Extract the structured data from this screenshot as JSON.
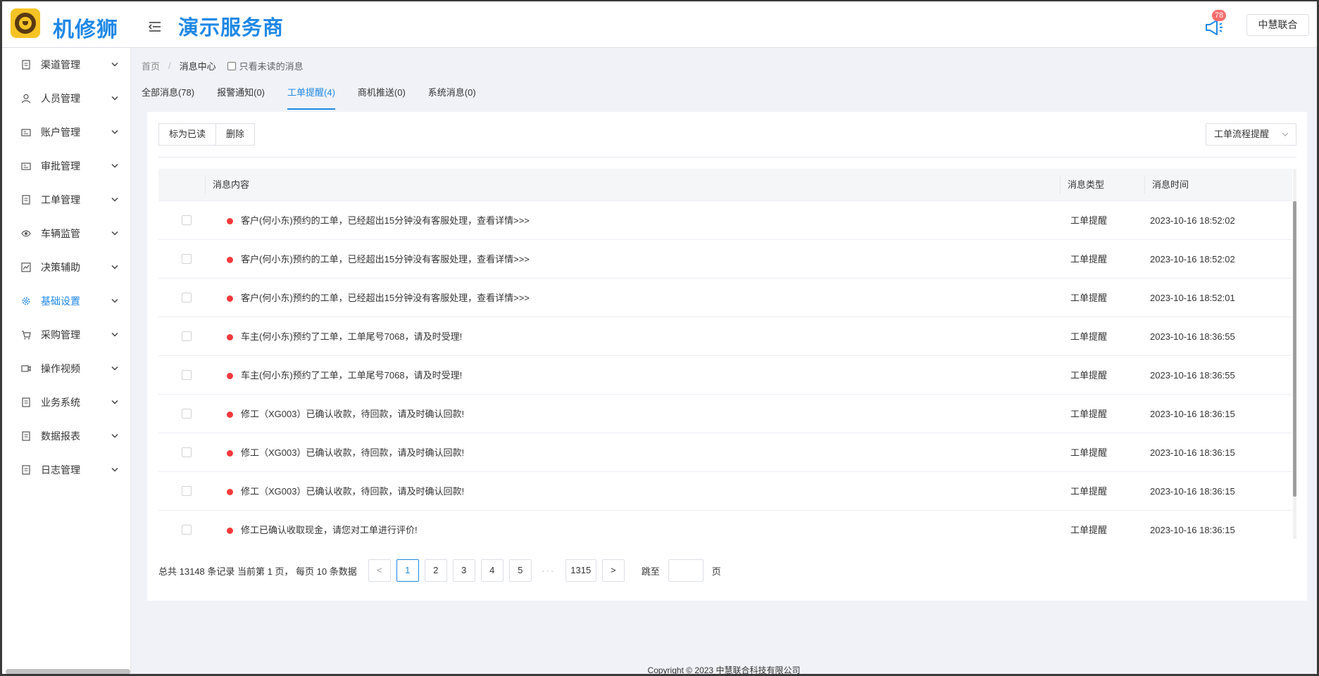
{
  "header": {
    "app_name": "机修狮",
    "provider": "演示服务商",
    "notification_count": "78",
    "org_button": "中慧联合"
  },
  "sidebar": {
    "items": [
      {
        "label": "渠道管理",
        "icon": "document-icon"
      },
      {
        "label": "人员管理",
        "icon": "user-icon"
      },
      {
        "label": "账户管理",
        "icon": "id-card-icon"
      },
      {
        "label": "审批管理",
        "icon": "id-card-icon"
      },
      {
        "label": "工单管理",
        "icon": "document-icon"
      },
      {
        "label": "车辆监管",
        "icon": "eye-icon"
      },
      {
        "label": "决策辅助",
        "icon": "chart-icon"
      },
      {
        "label": "基础设置",
        "icon": "gear-icon",
        "active": true
      },
      {
        "label": "采购管理",
        "icon": "cart-icon"
      },
      {
        "label": "操作视频",
        "icon": "video-icon"
      },
      {
        "label": "业务系统",
        "icon": "document-icon"
      },
      {
        "label": "数据报表",
        "icon": "document-icon"
      },
      {
        "label": "日志管理",
        "icon": "document-icon"
      }
    ]
  },
  "breadcrumb": {
    "home": "首页",
    "separator": "/",
    "current": "消息中心",
    "unread_only_label": "只看未读的消息"
  },
  "tabs": [
    {
      "label": "全部消息(78)"
    },
    {
      "label": "报警通知(0)"
    },
    {
      "label": "工单提醒(4)",
      "active": true
    },
    {
      "label": "商机推送(0)"
    },
    {
      "label": "系统消息(0)"
    }
  ],
  "toolbar": {
    "mark_read": "标为已读",
    "delete": "删除",
    "filter_value": "工单流程提醒"
  },
  "table": {
    "columns": [
      "消息内容",
      "消息类型",
      "消息时间"
    ],
    "rows": [
      {
        "content": "客户(何小东)预约的工单，已经超出15分钟没有客服处理，查看详情>>>",
        "type": "工单提醒",
        "time": "2023-10-16 18:52:02"
      },
      {
        "content": "客户(何小东)预约的工单，已经超出15分钟没有客服处理，查看详情>>>",
        "type": "工单提醒",
        "time": "2023-10-16 18:52:02"
      },
      {
        "content": "客户(何小东)预约的工单，已经超出15分钟没有客服处理，查看详情>>>",
        "type": "工单提醒",
        "time": "2023-10-16 18:52:01"
      },
      {
        "content": "车主(何小东)预约了工单，工单尾号7068，请及时受理!",
        "type": "工单提醒",
        "time": "2023-10-16 18:36:55"
      },
      {
        "content": "车主(何小东)预约了工单，工单尾号7068，请及时受理!",
        "type": "工单提醒",
        "time": "2023-10-16 18:36:55"
      },
      {
        "content": "修工（XG003）已确认收款，待回款，请及时确认回款!",
        "type": "工单提醒",
        "time": "2023-10-16 18:36:15"
      },
      {
        "content": "修工（XG003）已确认收款，待回款，请及时确认回款!",
        "type": "工单提醒",
        "time": "2023-10-16 18:36:15"
      },
      {
        "content": "修工（XG003）已确认收款，待回款，请及时确认回款!",
        "type": "工单提醒",
        "time": "2023-10-16 18:36:15"
      },
      {
        "content": "修工已确认收取现金，请您对工单进行评价!",
        "type": "工单提醒",
        "time": "2023-10-16 18:36:15"
      }
    ],
    "status_color": "#f2393b"
  },
  "pagination": {
    "summary": "总共 13148 条记录 当前第 1 页， 每页 10 条数据",
    "prev": "<",
    "pages": [
      "1",
      "2",
      "3",
      "4",
      "5"
    ],
    "ellipsis": "···",
    "last": "1315",
    "next": ">",
    "jump_label": "跳至",
    "page_unit": "页"
  },
  "footer": {
    "copyright": "Copyright © 2023 中慧联合科技有限公司"
  },
  "colors": {
    "accent": "#1e88e5",
    "badge": "#f56c6c"
  }
}
